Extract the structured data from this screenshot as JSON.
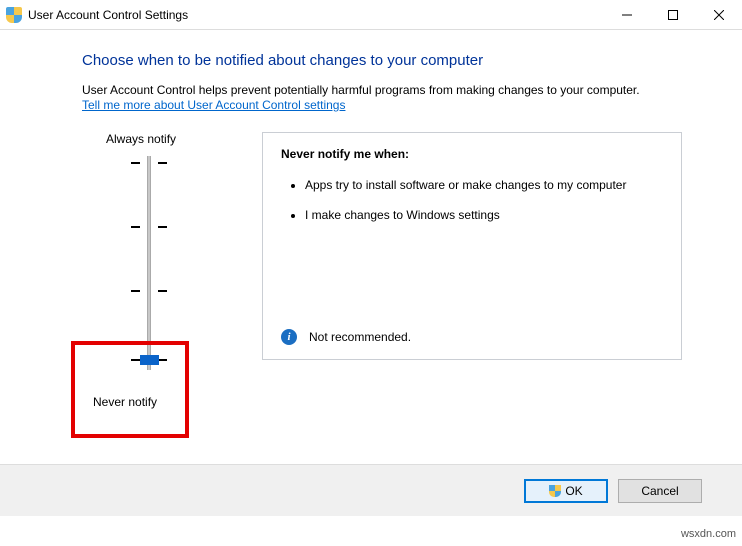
{
  "window": {
    "title": "User Account Control Settings"
  },
  "heading": "Choose when to be notified about changes to your computer",
  "description": "User Account Control helps prevent potentially harmful programs from making changes to your computer.",
  "link": "Tell me more about User Account Control settings",
  "slider": {
    "topLabel": "Always notify",
    "bottomLabel": "Never notify"
  },
  "panel": {
    "title": "Never notify me when:",
    "items": [
      "Apps try to install software or make changes to my computer",
      "I make changes to Windows settings"
    ],
    "footer": "Not recommended."
  },
  "buttons": {
    "ok": "OK",
    "cancel": "Cancel"
  },
  "watermark": "wsxdn.com"
}
